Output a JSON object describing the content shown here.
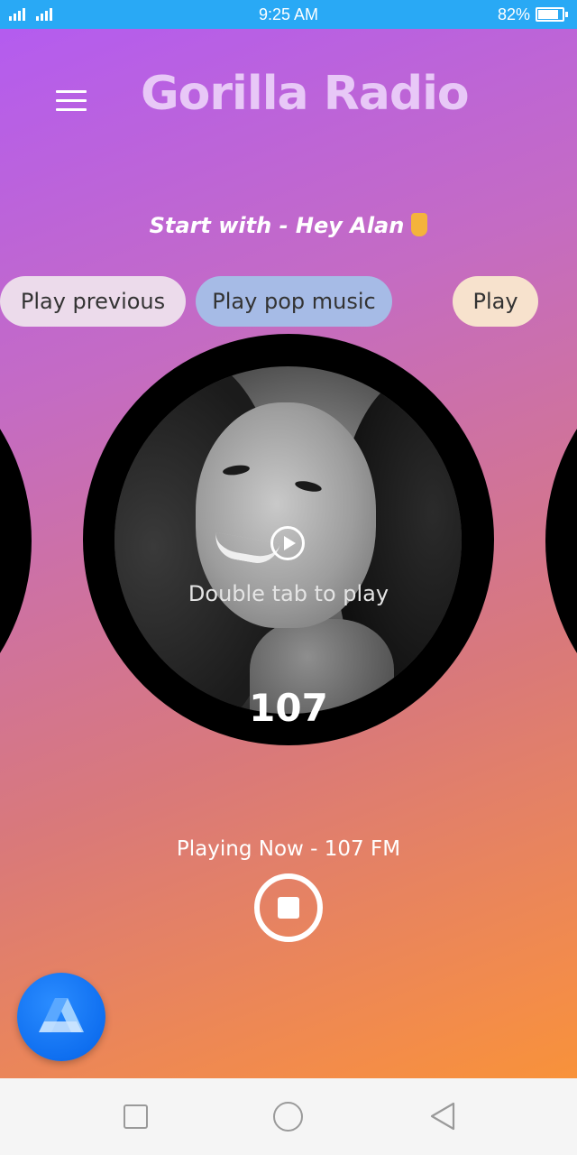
{
  "status_bar": {
    "network": "3G 4G",
    "time": "9:25 AM",
    "battery": "82%"
  },
  "header": {
    "title": "Gorilla Radio"
  },
  "hint": {
    "text": "Start with - Hey Alan"
  },
  "chips": [
    {
      "label": "Play previous"
    },
    {
      "label": "Play pop music"
    },
    {
      "label": "Play"
    }
  ],
  "station": {
    "action_text": "Double tab to play",
    "frequency": "107"
  },
  "now_playing": {
    "text": "Playing Now - 107 FM"
  },
  "colors": {
    "status_bar": "#29a9f5",
    "gradient_top": "#b45cef",
    "gradient_bottom": "#f8923a",
    "title": "#e8c8f7",
    "alan_button": "#0f6ff0"
  },
  "icons": [
    "menu-icon",
    "pointing-hand-icon",
    "play-icon",
    "stop-icon",
    "alan-logo-icon",
    "square-icon",
    "circle-icon",
    "back-triangle-icon"
  ]
}
